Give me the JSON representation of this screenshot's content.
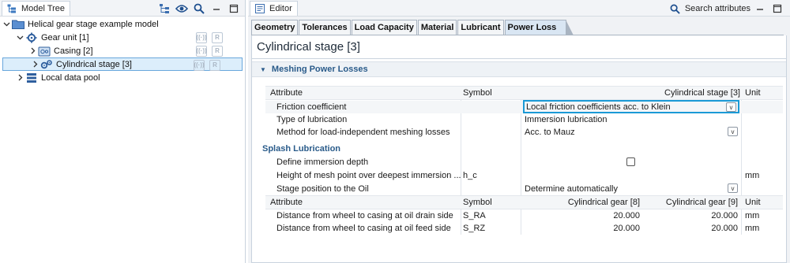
{
  "model_tree": {
    "tab_label": "Model Tree",
    "items": [
      {
        "label": "Helical gear stage example model"
      },
      {
        "label": "Gear unit [1]"
      },
      {
        "label": "Casing [2]"
      },
      {
        "label": "Cylindrical stage [3]"
      },
      {
        "label": "Local data pool"
      }
    ]
  },
  "editor": {
    "tab_label": "Editor",
    "search_label": "Search attributes",
    "tabs": [
      {
        "label": "Geometry"
      },
      {
        "label": "Tolerances"
      },
      {
        "label": "Load Capacity"
      },
      {
        "label": "Material"
      },
      {
        "label": "Lubricant"
      },
      {
        "label": "Power Loss"
      }
    ],
    "active_tab": "Power Loss",
    "title": "Cylindrical stage [3]",
    "section_title": "Meshing Power Losses",
    "table_headers": {
      "attribute": "Attribute",
      "symbol": "Symbol",
      "value": "Cylindrical stage [3]",
      "unit": "Unit"
    },
    "rows": [
      {
        "attribute": "Friction coefficient",
        "symbol": "",
        "value": "Local friction coefficients acc. to Klein",
        "unit": ""
      },
      {
        "attribute": "Type of lubrication",
        "symbol": "",
        "value": "Immersion lubrication",
        "unit": ""
      },
      {
        "attribute": "Method for load-independent meshing losses",
        "symbol": "",
        "value": "Acc. to Mauz",
        "unit": ""
      }
    ],
    "splash_title": "Splash Lubrication",
    "splash_rows": [
      {
        "attribute": "Define immersion depth",
        "symbol": "",
        "checked": false,
        "unit": ""
      },
      {
        "attribute": "Height of mesh point over deepest immersion ...",
        "symbol": "h_c",
        "value": "",
        "unit": "mm"
      },
      {
        "attribute": "Stage position to the Oil",
        "symbol": "",
        "value": "Determine automatically",
        "unit": ""
      }
    ],
    "table2_headers": {
      "attribute": "Attribute",
      "symbol": "Symbol",
      "col1": "Cylindrical gear [8]",
      "col2": "Cylindrical gear [9]",
      "unit": "Unit"
    },
    "table2_rows": [
      {
        "attribute": "Distance from wheel to casing at oil drain side",
        "symbol": "S_RA",
        "col1": "20.000",
        "col2": "20.000",
        "unit": "mm"
      },
      {
        "attribute": "Distance from wheel to casing at oil feed side",
        "symbol": "S_RZ",
        "col1": "20.000",
        "col2": "20.000",
        "unit": "mm"
      }
    ],
    "dropdown_glyph": "v"
  },
  "colors": {
    "accent": "#1b9ad6",
    "section_text": "#2a5b8a",
    "selection": "#dceefb"
  }
}
